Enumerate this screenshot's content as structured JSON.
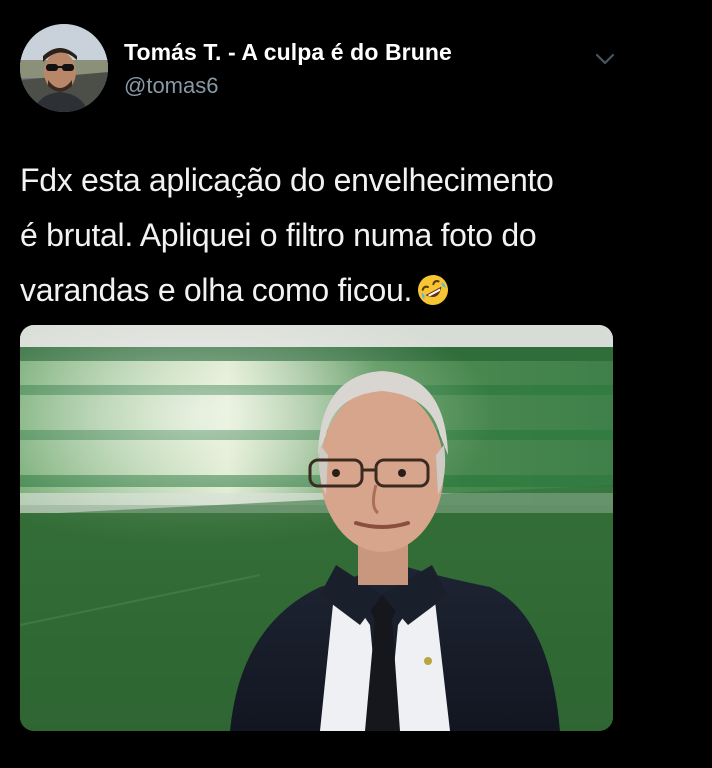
{
  "tweet": {
    "display_name": "Tomás T. - A culpa é do Brune",
    "handle": "@tomas6",
    "text_lines": [
      "Fdx esta aplicação do envelhecimento",
      "é  brutal. Apliquei o filtro numa foto do",
      "varandas e olha como ficou."
    ],
    "emoji": "rolling-on-the-floor-laughing",
    "icons": {
      "menu": "chevron-down-icon"
    },
    "colors": {
      "background": "#000000",
      "name": "#ffffff",
      "handle": "#8899a6",
      "text": "#f2f2f2"
    }
  }
}
